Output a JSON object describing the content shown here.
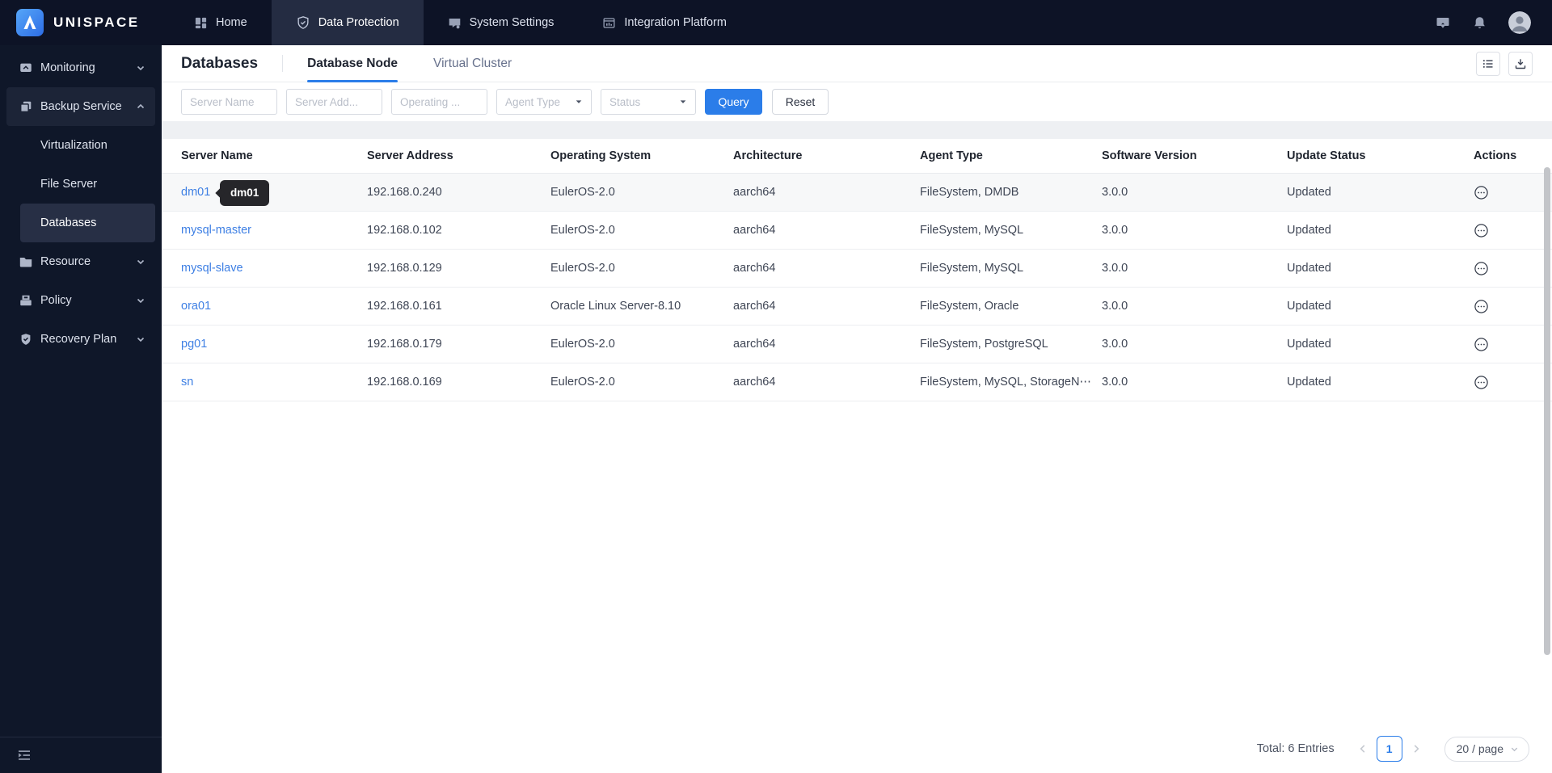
{
  "brand": {
    "name": "UNISPACE"
  },
  "topnav": {
    "items": [
      {
        "label": "Home",
        "active": false
      },
      {
        "label": "Data Protection",
        "active": true
      },
      {
        "label": "System Settings",
        "active": false
      },
      {
        "label": "Integration Platform",
        "active": false
      }
    ]
  },
  "sidebar": {
    "monitoring": "Monitoring",
    "backup_service": "Backup Service",
    "virtualization": "Virtualization",
    "file_server": "File Server",
    "databases": "Databases",
    "resource": "Resource",
    "policy": "Policy",
    "recovery_plan": "Recovery Plan"
  },
  "page": {
    "title": "Databases",
    "tab_database_node": "Database Node",
    "tab_virtual_cluster": "Virtual Cluster"
  },
  "filters": {
    "server_name": "Server Name",
    "server_address": "Server Add...",
    "operating_system": "Operating ...",
    "agent_type": "Agent Type",
    "status": "Status",
    "query": "Query",
    "reset": "Reset"
  },
  "table": {
    "columns": [
      "Server Name",
      "Server Address",
      "Operating System",
      "Architecture",
      "Agent Type",
      "Software Version",
      "Update Status",
      "Actions"
    ],
    "rows": [
      {
        "name": "dm01",
        "address": "192.168.0.240",
        "os": "EulerOS-2.0",
        "arch": "aarch64",
        "agent": "FileSystem, DMDB",
        "version": "3.0.0",
        "status": "Updated"
      },
      {
        "name": "mysql-master",
        "address": "192.168.0.102",
        "os": "EulerOS-2.0",
        "arch": "aarch64",
        "agent": "FileSystem, MySQL",
        "version": "3.0.0",
        "status": "Updated"
      },
      {
        "name": "mysql-slave",
        "address": "192.168.0.129",
        "os": "EulerOS-2.0",
        "arch": "aarch64",
        "agent": "FileSystem, MySQL",
        "version": "3.0.0",
        "status": "Updated"
      },
      {
        "name": "ora01",
        "address": "192.168.0.161",
        "os": "Oracle Linux Server-8.10",
        "arch": "aarch64",
        "agent": "FileSystem, Oracle",
        "version": "3.0.0",
        "status": "Updated"
      },
      {
        "name": "pg01",
        "address": "192.168.0.179",
        "os": "EulerOS-2.0",
        "arch": "aarch64",
        "agent": "FileSystem, PostgreSQL",
        "version": "3.0.0",
        "status": "Updated"
      },
      {
        "name": "sn",
        "address": "192.168.0.169",
        "os": "EulerOS-2.0",
        "arch": "aarch64",
        "agent": "FileSystem, MySQL, StorageN⋯",
        "version": "3.0.0",
        "status": "Updated"
      }
    ]
  },
  "tooltip": {
    "text": "dm01"
  },
  "pagination": {
    "total": "Total: 6 Entries",
    "page": "1",
    "page_size": "20 / page"
  },
  "colors": {
    "accent_blue": "#2b7de9",
    "link_blue": "#3f80e4",
    "topbar_bg": "#0d1326",
    "sidebar_bg": "#0f1729",
    "tooltip_bg": "#26262a"
  }
}
